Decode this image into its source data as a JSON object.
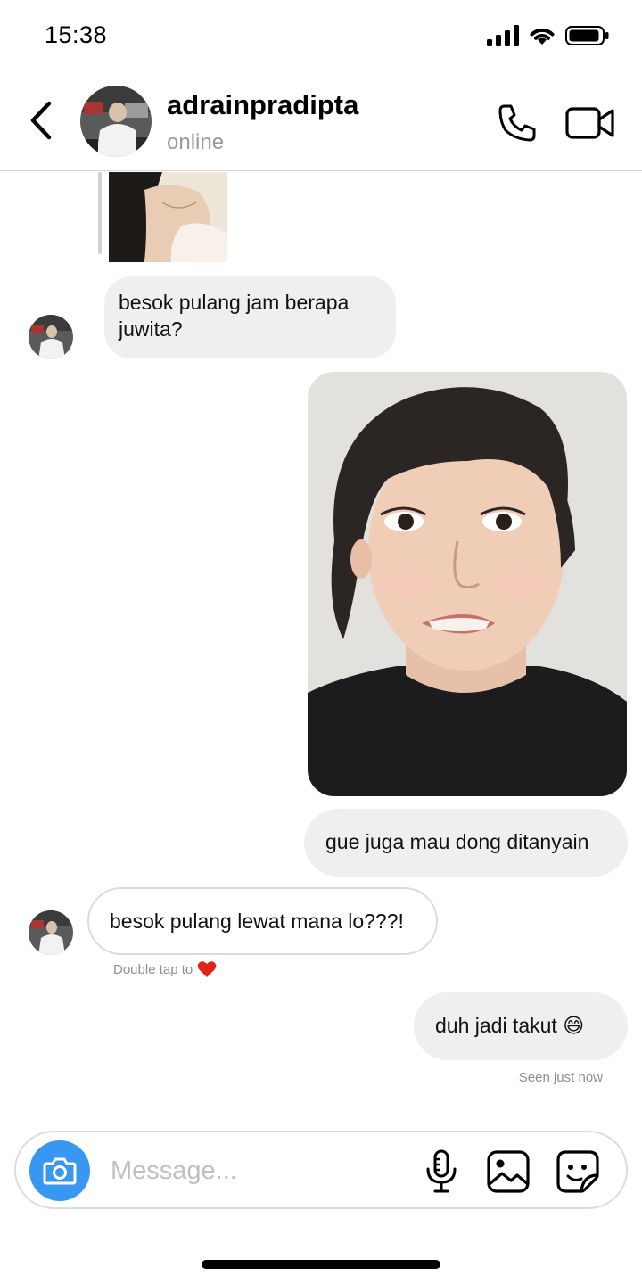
{
  "status_bar": {
    "time": "15:38",
    "icons": [
      "signal-icon",
      "wifi-icon",
      "battery-icon"
    ]
  },
  "header": {
    "contact_name": "adrainpradipta",
    "contact_status": "online",
    "icons": [
      "back-chevron-icon",
      "phone-icon",
      "video-camera-icon"
    ]
  },
  "messages": [
    {
      "type": "photo-reply",
      "from": "contact"
    },
    {
      "type": "text",
      "from": "contact",
      "text": "besok pulang jam berapa juwita?"
    },
    {
      "type": "photo",
      "from": "me"
    },
    {
      "type": "text",
      "from": "me",
      "text": "gue juga mau dong ditanyain"
    },
    {
      "type": "text",
      "from": "contact",
      "text": "besok pulang lewat mana lo???!"
    },
    {
      "type": "text",
      "from": "me",
      "text": "duh jadi takut 😄"
    }
  ],
  "hint": {
    "text": "Double tap to",
    "emoji": "❤️"
  },
  "seen_label": "Seen just now",
  "composer": {
    "placeholder": "Message...",
    "icons": [
      "camera-icon",
      "microphone-icon",
      "gallery-icon",
      "sticker-icon"
    ]
  },
  "colors": {
    "accent": "#3897f0",
    "bubble": "#efefef",
    "muted_text": "#8e8e8e",
    "heart": "#e0241b"
  }
}
